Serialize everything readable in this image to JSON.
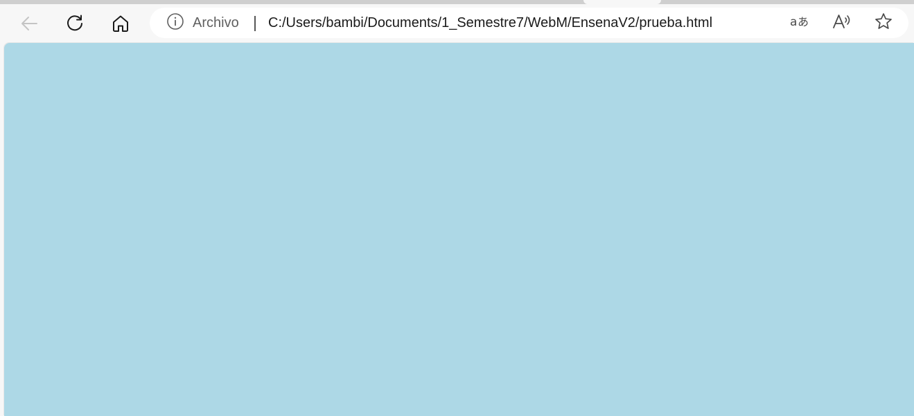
{
  "browser": {
    "site_info_label": "Archivo",
    "url": "C:/Users/bambi/Documents/1_Semestre7/WebM/EnsenaV2/prueba.html",
    "icons": {
      "back": "back-arrow-icon",
      "refresh": "refresh-icon",
      "home": "home-icon",
      "site_info": "info-icon",
      "translate": "translate-icon",
      "read_aloud": "read-aloud-icon",
      "favorite": "favorite-star-icon"
    },
    "back_enabled": false
  },
  "page": {
    "background_color": "#add8e6"
  }
}
